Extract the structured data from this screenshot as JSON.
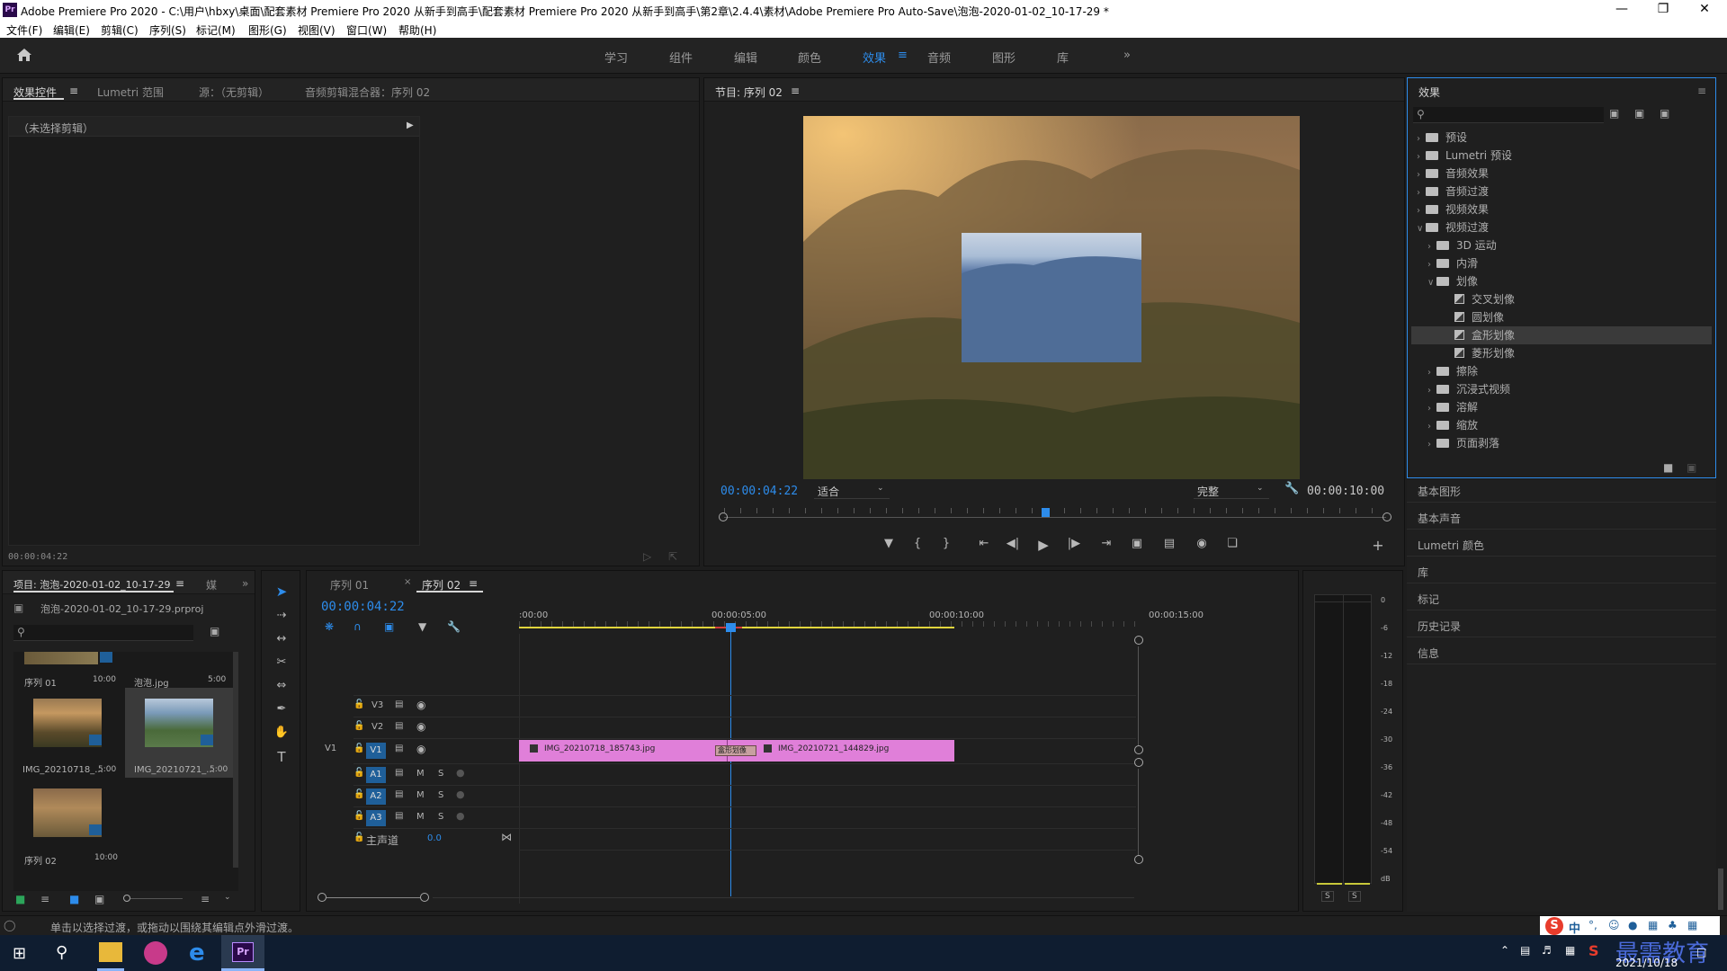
{
  "window": {
    "title": "Adobe Premiere Pro 2020 - C:\\用户\\hbxy\\桌面\\配套素材 Premiere Pro 2020 从新手到高手\\配套素材 Premiere Pro 2020 从新手到高手\\第2章\\2.4.4\\素材\\Adobe Premiere Pro Auto-Save\\泡泡-2020-01-02_10-17-29 *",
    "logo": "Pr"
  },
  "menu": [
    "文件(F)",
    "编辑(E)",
    "剪辑(C)",
    "序列(S)",
    "标记(M)",
    "图形(G)",
    "视图(V)",
    "窗口(W)",
    "帮助(H)"
  ],
  "workspaces": [
    "学习",
    "组件",
    "编辑",
    "颜色",
    "效果",
    "音频",
    "图形",
    "库"
  ],
  "active_workspace": "效果",
  "left_panel": {
    "tabs": [
      "效果控件",
      "Lumetri 范围",
      "源：（无剪辑）",
      "音频剪辑混合器：序列 02"
    ],
    "no_clip": "（未选择剪辑）",
    "timecode": "00:00:04:22"
  },
  "program": {
    "title": "节目: 序列 02",
    "timecode": "00:00:04:22",
    "fit": "适合",
    "quality": "完整",
    "duration": "00:00:10:00"
  },
  "effects": {
    "title": "效果",
    "tree": [
      {
        "label": "预设",
        "level": 0,
        "type": "preset"
      },
      {
        "label": "Lumetri 预设",
        "level": 0,
        "type": "preset"
      },
      {
        "label": "音频效果",
        "level": 0,
        "type": "folder"
      },
      {
        "label": "音频过渡",
        "level": 0,
        "type": "folder"
      },
      {
        "label": "视频效果",
        "level": 0,
        "type": "folder"
      },
      {
        "label": "视频过渡",
        "level": 0,
        "type": "folder",
        "open": true
      },
      {
        "label": "3D 运动",
        "level": 1,
        "type": "folder"
      },
      {
        "label": "内滑",
        "level": 1,
        "type": "folder"
      },
      {
        "label": "划像",
        "level": 1,
        "type": "folder",
        "open": true
      },
      {
        "label": "交叉划像",
        "level": 2,
        "type": "fx"
      },
      {
        "label": "圆划像",
        "level": 2,
        "type": "fx"
      },
      {
        "label": "盒形划像",
        "level": 2,
        "type": "fx",
        "selected": true
      },
      {
        "label": "菱形划像",
        "level": 2,
        "type": "fx"
      },
      {
        "label": "擦除",
        "level": 1,
        "type": "folder"
      },
      {
        "label": "沉浸式视频",
        "level": 1,
        "type": "folder"
      },
      {
        "label": "溶解",
        "level": 1,
        "type": "folder"
      },
      {
        "label": "缩放",
        "level": 1,
        "type": "folder"
      },
      {
        "label": "页面剥落",
        "level": 1,
        "type": "folder"
      }
    ]
  },
  "side_panels": [
    "基本图形",
    "基本声音",
    "Lumetri 颜色",
    "库",
    "标记",
    "历史记录",
    "信息"
  ],
  "project": {
    "tab": "项目: 泡泡-2020-01-02_10-17-29",
    "tab2": "媒",
    "file": "泡泡-2020-01-02_10-17-29.prproj",
    "items": [
      {
        "name": "序列 01",
        "dur": "10:00"
      },
      {
        "name": "泡泡.jpg",
        "dur": "5:00"
      },
      {
        "name": "IMG_20210718_...",
        "dur": "5:00"
      },
      {
        "name": "IMG_20210721_...",
        "dur": "5:00"
      },
      {
        "name": "序列 02",
        "dur": "10:00"
      }
    ]
  },
  "timeline": {
    "tabs": [
      "序列 01",
      "序列 02"
    ],
    "timecode": "00:00:04:22",
    "ruler": [
      ":00:00",
      "00:00:05:00",
      "00:00:10:00",
      "00:00:15:00"
    ],
    "video_tracks": [
      "V3",
      "V2",
      "V1"
    ],
    "audio_tracks": [
      "A1",
      "A2",
      "A3"
    ],
    "master": "主声道",
    "master_val": "0.0",
    "source_v1": "V1",
    "clips": [
      "IMG_20210718_185743.jpg",
      "IMG_20210721_144829.jpg"
    ],
    "transition": "盒形划像",
    "mute": "M",
    "solo": "S"
  },
  "meter": {
    "scale": [
      "0",
      "-6",
      "-12",
      "-18",
      "-24",
      "-30",
      "-36",
      "-42",
      "-48",
      "-54",
      "dB"
    ],
    "solo": [
      "S",
      "S"
    ]
  },
  "status": "单击以选择过渡，或拖动以围绕其编辑点外滑过渡。",
  "tray": {
    "ime": "中",
    "watermark": "最需教育",
    "date": "2021/10/18"
  }
}
